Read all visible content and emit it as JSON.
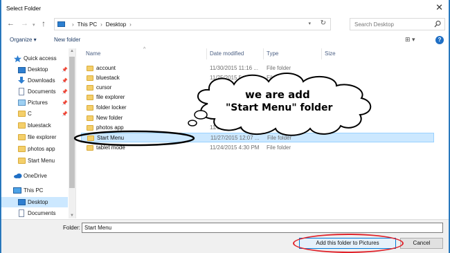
{
  "window": {
    "title": "Select Folder",
    "close_symbol": "✕"
  },
  "address": {
    "breadcrumbs": [
      "This PC",
      "Desktop"
    ],
    "separator": "›",
    "search_placeholder": "Search Desktop"
  },
  "toolbar": {
    "organize_label": "Organize ▾",
    "new_folder_label": "New folder",
    "view_label": "⊞ ▾",
    "help_label": "?"
  },
  "nav": {
    "items": [
      {
        "label": "Quick access",
        "icon": "star-icon",
        "pinned": false
      },
      {
        "label": "Desktop",
        "icon": "desktop-icon",
        "pinned": true
      },
      {
        "label": "Downloads",
        "icon": "download-icon",
        "pinned": true
      },
      {
        "label": "Documents",
        "icon": "documents-icon",
        "pinned": true
      },
      {
        "label": "Pictures",
        "icon": "pictures-icon",
        "pinned": true
      },
      {
        "label": "C",
        "icon": "folder-icon",
        "pinned": true
      },
      {
        "label": "bluestack",
        "icon": "folder-icon",
        "pinned": false
      },
      {
        "label": "file explorer",
        "icon": "folder-icon",
        "pinned": false
      },
      {
        "label": "photos app",
        "icon": "folder-icon",
        "pinned": false
      },
      {
        "label": "Start Menu",
        "icon": "folder-icon",
        "pinned": false
      },
      {
        "label": "OneDrive",
        "icon": "cloud-icon",
        "pinned": false
      },
      {
        "label": "This PC",
        "icon": "pc-icon",
        "pinned": false
      },
      {
        "label": "Desktop",
        "icon": "desktop-icon",
        "pinned": false
      },
      {
        "label": "Documents",
        "icon": "documents-icon",
        "pinned": false
      }
    ],
    "selected_index": 12
  },
  "columns": {
    "name": "Name",
    "date": "Date modified",
    "type": "Type",
    "size": "Size"
  },
  "files": [
    {
      "name": "account",
      "date": "11/30/2015 11:16 ...",
      "type": "File folder"
    },
    {
      "name": "bluestack",
      "date": "11/25/2015 5:41 PM",
      "type": "File folder"
    },
    {
      "name": "cursor",
      "date": "11/25/2015 5:29 PM",
      "type": "File folder"
    },
    {
      "name": "file explorer",
      "date": "11/24/2015 6:50 PM",
      "type": "File folder"
    },
    {
      "name": "folder locker",
      "date": "11/19/2015 4:00 PM",
      "type": "File folder"
    },
    {
      "name": "New folder",
      "date": "11/16/2015 4:59 PM",
      "type": "File folder"
    },
    {
      "name": "photos app",
      "date": "11/24/2015 3:59 PM",
      "type": "File folder"
    },
    {
      "name": "Start Menu",
      "date": "11/27/2015 12:07 ...",
      "type": "File folder"
    },
    {
      "name": "tablet mode",
      "date": "11/24/2015 4:30 PM",
      "type": "File folder"
    }
  ],
  "selected_file_index": 7,
  "bottom": {
    "folder_label": "Folder:",
    "folder_value": "Start Menu",
    "primary_button": "Add this folder to Pictures",
    "cancel_button": "Cancel"
  },
  "annotation": {
    "line1": "we are add",
    "line2": "\"Start Menu\" folder",
    "ellipse_color": "#000000",
    "button_circle_color": "#e0222a"
  },
  "colors": {
    "selection": "#cce8ff",
    "folder": "#f4cf6a",
    "accent": "#0078d7"
  }
}
